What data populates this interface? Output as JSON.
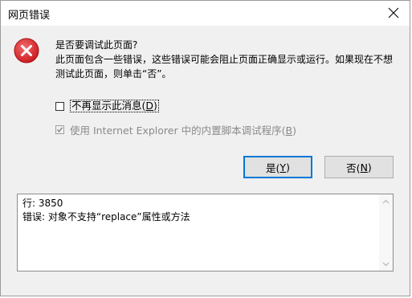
{
  "window": {
    "title": "网页错误"
  },
  "message": {
    "question": "是否要调试此页面?",
    "body": "此页面包含一些错误，这些错误可能会阻止页面正确显示或运行。如果现在不想测试此页面，则单击“否”。"
  },
  "options": {
    "dont_show_prefix": "不再显示此消息(",
    "dont_show_key": "D",
    "dont_show_suffix": ")",
    "dont_show_checked": false,
    "builtin_debugger_prefix": "使用 Internet Explorer 中的内置脚本调试程序(",
    "builtin_debugger_key": "B",
    "builtin_debugger_suffix": ")",
    "builtin_debugger_checked": true,
    "builtin_debugger_enabled": false
  },
  "buttons": {
    "yes_prefix": "是(",
    "yes_key": "Y",
    "yes_suffix": ")",
    "no_prefix": "否(",
    "no_key": "N",
    "no_suffix": ")"
  },
  "details": {
    "line1": "行: 3850",
    "line2": "错误: 对象不支持“replace”属性或方法"
  },
  "icons": {
    "error": "error-icon",
    "close": "close-icon"
  },
  "colors": {
    "error_red": "#d9252a",
    "focus_blue": "#0078d7"
  }
}
